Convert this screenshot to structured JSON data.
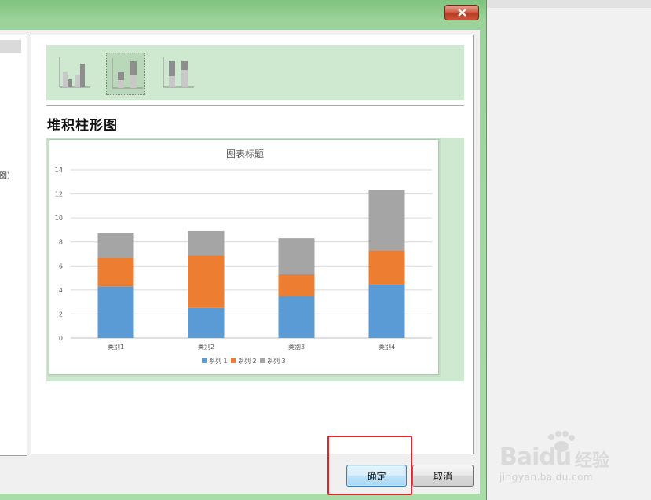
{
  "dialog": {
    "left_pane_fragment": "图）",
    "chart_type_title": "堆积柱形图",
    "buttons": {
      "ok": "确定",
      "cancel": "取消"
    }
  },
  "chart_thumbnails": [
    {
      "name": "clustered-column",
      "selected": false
    },
    {
      "name": "stacked-column",
      "selected": true
    },
    {
      "name": "100-percent-stacked-column",
      "selected": false
    }
  ],
  "chart_data": {
    "type": "bar",
    "stacked": true,
    "title": "图表标题",
    "categories": [
      "类别1",
      "类别2",
      "类别3",
      "类别4"
    ],
    "series": [
      {
        "name": "系列 1",
        "color": "#5b9bd5",
        "values": [
          4.3,
          2.5,
          3.5,
          4.5
        ]
      },
      {
        "name": "系列 2",
        "color": "#ed7d31",
        "values": [
          2.4,
          4.4,
          1.8,
          2.8
        ]
      },
      {
        "name": "系列 3",
        "color": "#a5a5a5",
        "values": [
          2.0,
          2.0,
          3.0,
          5.0
        ]
      }
    ],
    "ylim": [
      0,
      14
    ],
    "yticks": [
      "0",
      "2",
      "4",
      "6",
      "8",
      "10",
      "12",
      "14"
    ],
    "grid": true,
    "legend": "bottom"
  },
  "watermark": {
    "logo": "Baidu",
    "logo_cn": "经验",
    "url": "jingyan.baidu.com"
  },
  "colors": {
    "window_frame": "#a9dca8",
    "highlight": "#e3242b",
    "ok_button_border": "#3c7fb1"
  }
}
